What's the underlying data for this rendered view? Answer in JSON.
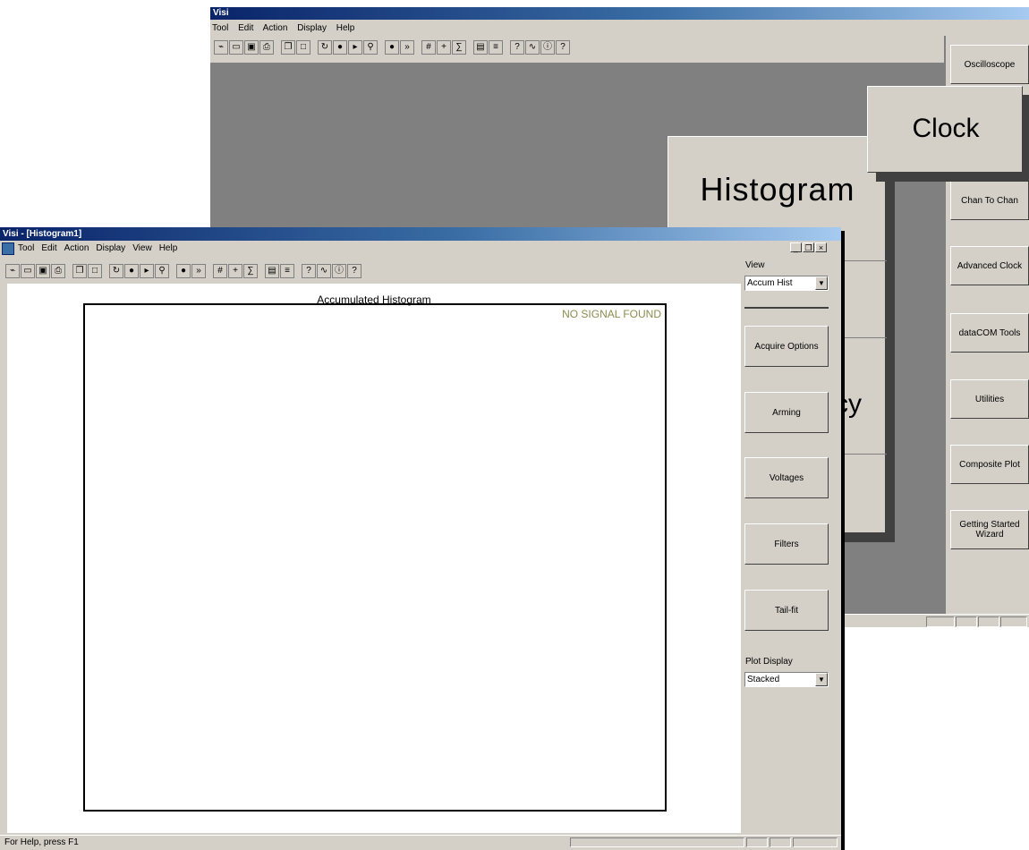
{
  "background_window": {
    "title": "Visi",
    "menu": [
      "Tool",
      "Edit",
      "Action",
      "Display",
      "Help"
    ],
    "right_panel": [
      "Oscilloscope",
      "Chan To Chan",
      "Advanced Clock",
      "dataCOM Tools",
      "Utilities",
      "Composite Plot",
      "Getting Started Wizard"
    ]
  },
  "big_buttons": {
    "histogram": "Histogram",
    "clock": "Clock",
    "partial": "cy"
  },
  "front_window": {
    "title": "Visi - [Histogram1]",
    "menu": [
      "Tool",
      "Edit",
      "Action",
      "Display",
      "View",
      "Help"
    ],
    "window_controls": [
      "_",
      "❐",
      "×"
    ],
    "plot": {
      "title": "Accumulated Histogram",
      "message": "NO SIGNAL FOUND"
    },
    "side_panel": {
      "view_label": "View",
      "view_value": "Accum Hist",
      "buttons": [
        "Acquire Options",
        "Arming",
        "Voltages",
        "Filters",
        "Tail-fit"
      ],
      "plot_display_label": "Plot Display",
      "plot_display_value": "Stacked"
    },
    "status": "For Help, press F1"
  },
  "toolbar_icons": [
    "plot-icon",
    "open-icon",
    "save-icon",
    "print-icon",
    "|",
    "copy-icon",
    "window-icon",
    "|",
    "repeat-icon",
    "stop-icon",
    "step-icon",
    "zoom-icon",
    "|",
    "record-icon",
    "fast-forward-icon",
    "|",
    "grid-icon",
    "add-icon",
    "stats-icon",
    "|",
    "calculator-icon",
    "notes-icon",
    "|",
    "help-icon",
    "filter-icon",
    "about-icon",
    "context-help-icon"
  ],
  "colors": {
    "title_start": "#0a246a",
    "title_end": "#a6caf0",
    "face": "#d4d0c8",
    "workspace": "#808080",
    "message": "#8c8c50"
  }
}
